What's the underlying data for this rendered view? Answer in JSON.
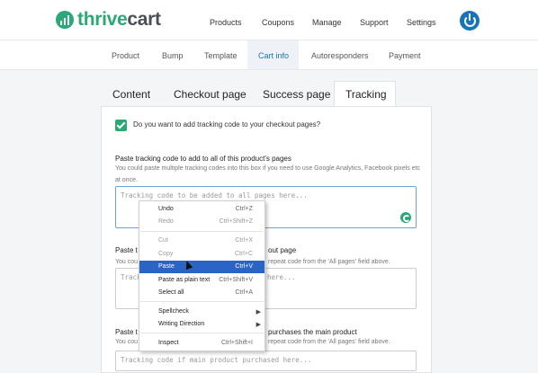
{
  "brand": {
    "name_a": "thrive",
    "name_b": "cart",
    "color": "#2aa876"
  },
  "nav": {
    "products": "Products",
    "coupons": "Coupons",
    "manage": "Manage",
    "support": "Support",
    "settings": "Settings"
  },
  "subnav": {
    "product": "Product",
    "bump": "Bump",
    "template": "Template",
    "cart_info": "Cart info",
    "autoresponders": "Autoresponders",
    "payment": "Payment"
  },
  "tabs": {
    "content": "Content",
    "checkout": "Checkout page",
    "success": "Success page",
    "tracking": "Tracking"
  },
  "tracking": {
    "checkbox_label": "Do you want to add tracking code to your checkout pages?",
    "checked": true,
    "all_pages_label": "Paste tracking code to add to all of this product's pages",
    "all_pages_help": "You could paste multiple tracking codes into this box if you need to use Google Analytics, Facebook pixels etc at once.",
    "all_pages_placeholder": "Tracking code to be added to all pages here...",
    "checkout_label_a": "Paste t",
    "checkout_label_b": "out page",
    "checkout_help_a": "You cou",
    "checkout_help_b": "repeat code from the 'All pages' field above.",
    "checkout_placeholder_a": "Track",
    "checkout_placeholder_b": "here...",
    "purchase_label_a": "Paste t",
    "purchase_label_b": "purchases the main product",
    "purchase_help_a": "You cou",
    "purchase_help_b": "repeat code from the 'All pages' field above.",
    "purchase_placeholder": "Tracking code if main product purchased here..."
  },
  "context_menu": {
    "undo": {
      "label": "Undo",
      "shortcut": "Ctrl+Z"
    },
    "redo": {
      "label": "Redo",
      "shortcut": "Ctrl+Shift+Z"
    },
    "cut": {
      "label": "Cut",
      "shortcut": "Ctrl+X"
    },
    "copy": {
      "label": "Copy",
      "shortcut": "Ctrl+C"
    },
    "paste": {
      "label": "Paste",
      "shortcut": "Ctrl+V"
    },
    "paste_plain": {
      "label": "Paste as plain text",
      "shortcut": "Ctrl+Shift+V"
    },
    "select_all": {
      "label": "Select all",
      "shortcut": "Ctrl+A"
    },
    "spellcheck": {
      "label": "Spellcheck"
    },
    "writing_direction": {
      "label": "Writing Direction"
    },
    "inspect": {
      "label": "Inspect",
      "shortcut": "Ctrl+Shift+I"
    }
  }
}
